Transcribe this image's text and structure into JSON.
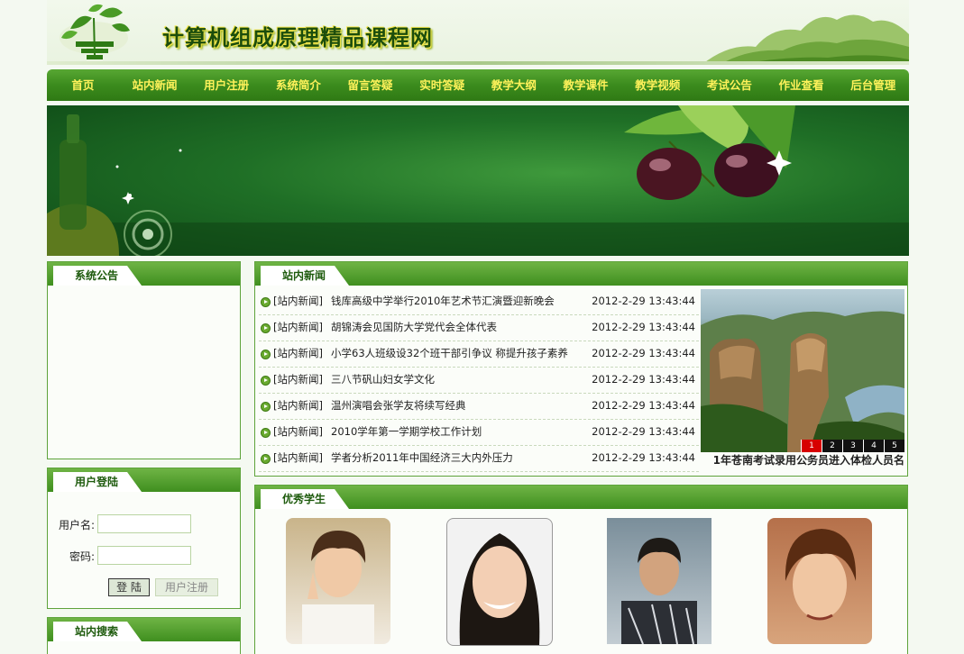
{
  "header": {
    "title": "计算机组成原理精品课程网"
  },
  "nav": {
    "items": [
      "首页",
      "站内新闻",
      "用户注册",
      "系统简介",
      "留言答疑",
      "实时答疑",
      "教学大纲",
      "教学课件",
      "教学视频",
      "考试公告",
      "作业查看",
      "后台管理"
    ]
  },
  "announce": {
    "title": "系统公告"
  },
  "login": {
    "title": "用户登陆",
    "username_label": "用户名:",
    "password_label": "密码:",
    "login_button": "登 陆",
    "register_button": "用户注册"
  },
  "search": {
    "title": "站内搜索"
  },
  "news": {
    "title": "站内新闻",
    "items": [
      {
        "tag": "[站内新闻]",
        "title": "钱库高级中学举行2010年艺术节汇演暨迎新晚会",
        "date": "2012-2-29  13:43:44"
      },
      {
        "tag": "[站内新闻]",
        "title": "胡锦涛会见国防大学党代会全体代表",
        "date": "2012-2-29  13:43:44"
      },
      {
        "tag": "[站内新闻]",
        "title": "小学63人班级设32个班干部引争议 称提升孩子素养",
        "date": "2012-2-29  13:43:44"
      },
      {
        "tag": "[站内新闻]",
        "title": "三八节矾山妇女学文化",
        "date": "2012-2-29  13:43:44"
      },
      {
        "tag": "[站内新闻]",
        "title": "温州演唱会张学友将续写经典",
        "date": "2012-2-29  13:43:44"
      },
      {
        "tag": "[站内新闻]",
        "title": "2010学年第一学期学校工作计划",
        "date": "2012-2-29  13:43:44"
      },
      {
        "tag": "[站内新闻]",
        "title": "学者分析2011年中国经济三大内外压力",
        "date": "2012-2-29  13:43:44"
      }
    ],
    "slider_numbers": [
      "1",
      "2",
      "3",
      "4",
      "5"
    ],
    "slider_caption": "1年苍南考试录用公务员进入体检人员名"
  },
  "students": {
    "title": "优秀学生"
  },
  "colors": {
    "nav_text": "#fff25a",
    "nav_bg": "#3b8b1d",
    "accent": "#5ea33b"
  }
}
